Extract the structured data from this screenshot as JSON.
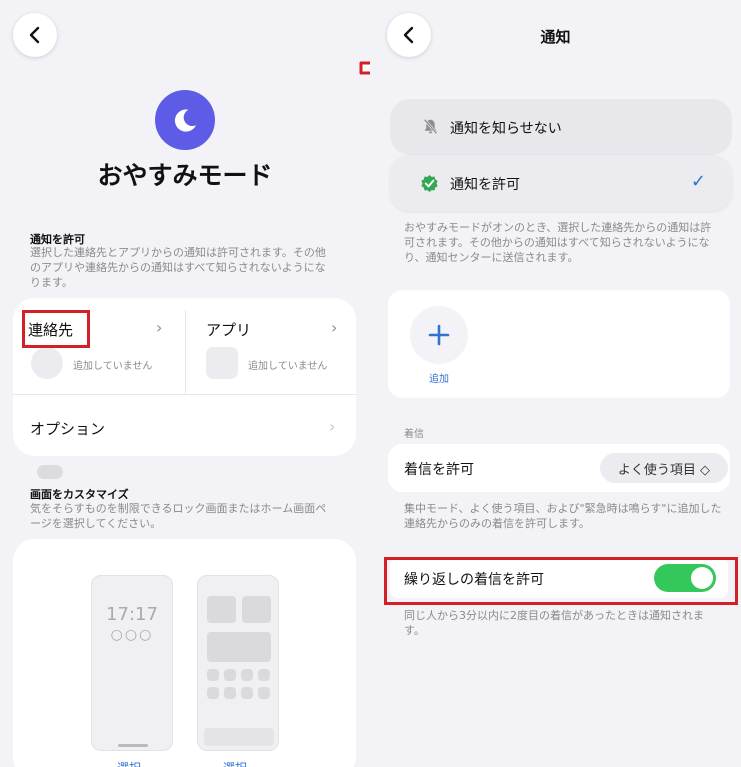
{
  "left": {
    "title": "おやすみモード",
    "allow_section": {
      "heading": "通知を許可",
      "description": "選択した連絡先とアプリからの通知は許可されます。その他のアプリや連絡先からの通知はすべて知らされないようになります。"
    },
    "contacts": {
      "label": "連絡先",
      "status": "追加していません"
    },
    "apps": {
      "label": "アプリ",
      "status": "追加していません"
    },
    "options_label": "オプション",
    "customize": {
      "heading": "画面をカスタマイズ",
      "description": "気をそらすものを制限できるロック画面またはホーム画面ページを選択してください。"
    },
    "lock_preview": {
      "time": "17:17",
      "dots": "○○○",
      "select_label": "選択"
    },
    "home_preview": {
      "select_label": "選択"
    }
  },
  "right": {
    "nav_title": "通知",
    "options": [
      {
        "label": "通知を知らせない",
        "icon": "bell-slash-icon",
        "selected": false
      },
      {
        "label": "通知を許可",
        "icon": "check-badge-icon",
        "selected": true
      }
    ],
    "check_mark": "✓",
    "allow_description": "おやすみモードがオンのとき、選択した連絡先からの通知は許可されます。その他からの通知はすべて知らされないようになり、通知センターに送信されます。",
    "add_label": "追加",
    "calls_heading": "着信",
    "allow_calls": {
      "label": "着信を許可",
      "value": "よく使う項目 ◇"
    },
    "calls_description": "集中モード、よく使う項目、および\"緊急時は鳴らす\"に追加した連絡先からのみの着信を許可します。",
    "repeated_calls": {
      "label": "繰り返しの着信を許可",
      "enabled": true
    },
    "repeated_description": "同じ人から3分以内に2度目の着信があったときは通知されます。"
  },
  "colors": {
    "accent": "#2f74d0",
    "moon": "#5e5ce6",
    "toggle_on": "#34c759",
    "highlight": "#d31f26"
  }
}
